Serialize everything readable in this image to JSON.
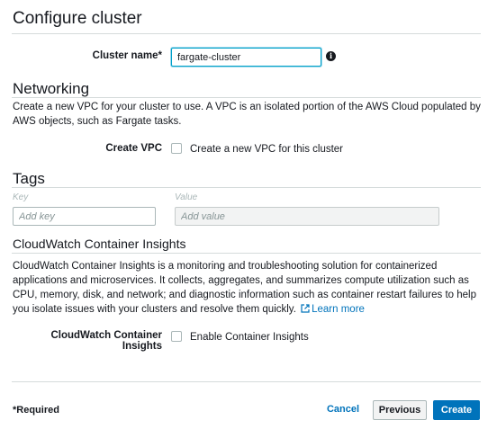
{
  "page_title": "Configure cluster",
  "cluster_name": {
    "label": "Cluster name*",
    "value": "fargate-cluster",
    "info_icon": "info-icon"
  },
  "networking": {
    "heading": "Networking",
    "description": "Create a new VPC for your cluster to use. A VPC is an isolated portion of the AWS Cloud populated by AWS objects, such as Fargate tasks.",
    "create_vpc_label": "Create VPC",
    "create_vpc_checkbox_text": "Create a new VPC for this cluster",
    "create_vpc_checked": false
  },
  "tags": {
    "heading": "Tags",
    "key_label": "Key",
    "value_label": "Value",
    "key_placeholder": "Add key",
    "value_placeholder": "Add value"
  },
  "insights": {
    "heading": "CloudWatch Container Insights",
    "description": "CloudWatch Container Insights is a monitoring and troubleshooting solution for containerized applications and microservices. It collects, aggregates, and summarizes compute utilization such as CPU, memory, disk, and network; and diagnostic information such as container restart failures to help you isolate issues with your clusters and resolve them quickly.",
    "learn_more": "Learn more",
    "field_label": "CloudWatch Container Insights",
    "checkbox_text": "Enable Container Insights",
    "checked": false
  },
  "footer": {
    "required_note": "*Required",
    "cancel_label": "Cancel",
    "previous_label": "Previous",
    "create_label": "Create"
  },
  "colors": {
    "accent": "#0073bb",
    "focus_border": "#00a1c9",
    "divider": "#d5dbdb"
  }
}
